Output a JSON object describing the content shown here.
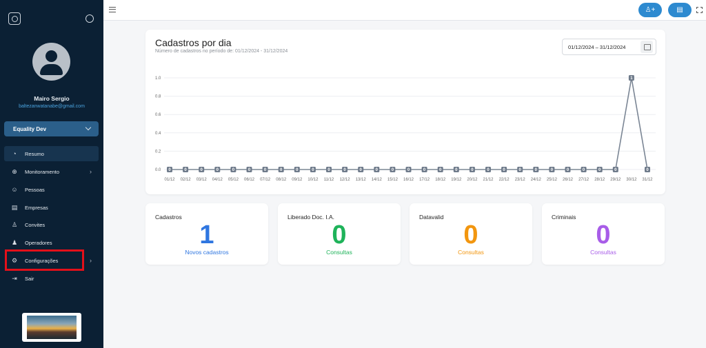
{
  "user": {
    "name": "Mairo Sergio",
    "email": "baltezanwatanabe@gmail.com"
  },
  "company": {
    "selected": "Equality Dev"
  },
  "nav": [
    {
      "label": "Resumo",
      "icon": "pie-chart-icon",
      "active": true,
      "has_arrow": false
    },
    {
      "label": "Monitoramento",
      "icon": "globe-icon",
      "active": false,
      "has_arrow": true
    },
    {
      "label": "Pessoas",
      "icon": "people-icon",
      "active": false,
      "has_arrow": false
    },
    {
      "label": "Empresas",
      "icon": "store-icon",
      "active": false,
      "has_arrow": false
    },
    {
      "label": "Convites",
      "icon": "user-add-icon",
      "active": false,
      "has_arrow": false
    },
    {
      "label": "Operadores",
      "icon": "operators-icon",
      "active": false,
      "has_arrow": false
    },
    {
      "label": "Configurações",
      "icon": "gear-icon",
      "active": false,
      "has_arrow": true
    },
    {
      "label": "Sair",
      "icon": "logout-icon",
      "active": false,
      "has_arrow": false
    }
  ],
  "accent": "#2d8ad0",
  "chart_card": {
    "title": "Cadastros por dia",
    "subtitle": "Número de cadastros no período de: 01/12/2024 - 31/12/2024",
    "date_range": "01/12/2024 – 31/12/2024"
  },
  "chart_data": {
    "type": "line",
    "title": "Cadastros por dia",
    "xlabel": "",
    "ylabel": "",
    "ylim": [
      0,
      1
    ],
    "yticks": [
      "0.0",
      "0.2",
      "0.4",
      "0.6",
      "0.8",
      "1.0"
    ],
    "grid": true,
    "categories": [
      "01/12",
      "02/12",
      "03/12",
      "04/12",
      "05/12",
      "06/12",
      "07/12",
      "08/12",
      "09/12",
      "10/12",
      "11/12",
      "12/12",
      "13/12",
      "14/12",
      "15/12",
      "16/12",
      "17/12",
      "18/12",
      "19/12",
      "20/12",
      "21/12",
      "22/12",
      "23/12",
      "24/12",
      "25/12",
      "26/12",
      "27/12",
      "28/12",
      "29/12",
      "30/12",
      "31/12"
    ],
    "values": [
      0,
      0,
      0,
      0,
      0,
      0,
      0,
      0,
      0,
      0,
      0,
      0,
      0,
      0,
      0,
      0,
      0,
      0,
      0,
      0,
      0,
      0,
      0,
      0,
      0,
      0,
      0,
      0,
      0,
      1,
      0
    ],
    "line_color": "#7a8594"
  },
  "stats": [
    {
      "title": "Cadastros",
      "value": "1",
      "label": "Novos cadastros",
      "color": "#2f76e0"
    },
    {
      "title": "Liberado Doc. I.A.",
      "value": "0",
      "label": "Consultas",
      "color": "#1fb35a"
    },
    {
      "title": "Datavalid",
      "value": "0",
      "label": "Consultas",
      "color": "#f2960f"
    },
    {
      "title": "Criminais",
      "value": "0",
      "label": "Consultas",
      "color": "#a85de8"
    }
  ]
}
